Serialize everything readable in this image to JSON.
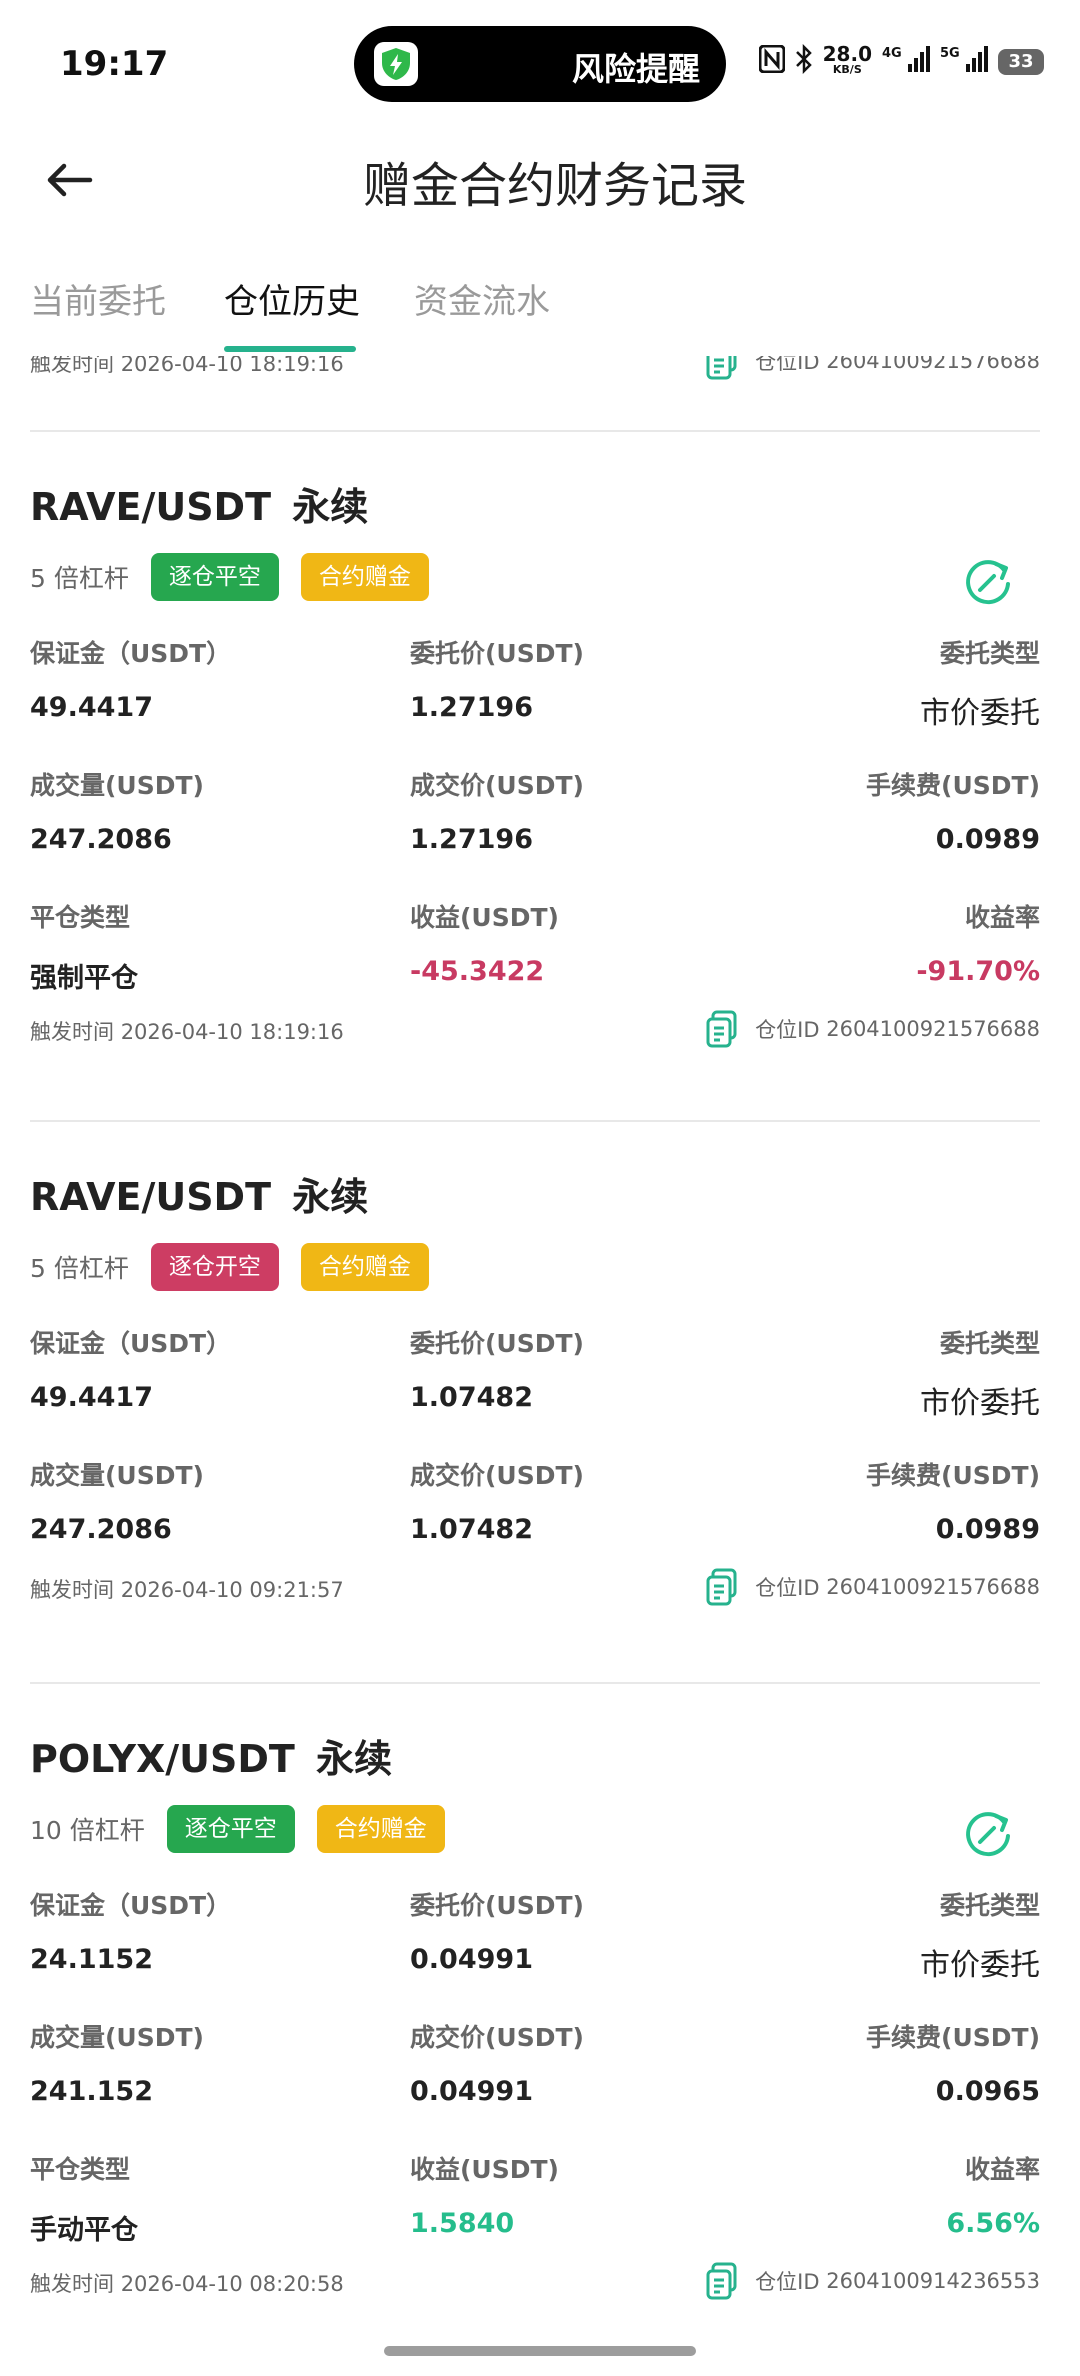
{
  "status_bar": {
    "time": "19:17",
    "island_text": "风险提醒",
    "network_speed": "28.0",
    "network_unit": "KB/S",
    "signal1": "4G",
    "signal2": "5G",
    "battery": "33"
  },
  "header": {
    "title": "赠金合约财务记录"
  },
  "tabs": [
    {
      "label": "当前委托",
      "active": false
    },
    {
      "label": "仓位历史",
      "active": true
    },
    {
      "label": "资金流水",
      "active": false
    }
  ],
  "labels": {
    "margin": "保证金（USDT）",
    "order_price": "委托价(USDT)",
    "order_type": "委托类型",
    "volume": "成交量(USDT)",
    "fill_price": "成交价(USDT)",
    "fee": "手续费(USDT)",
    "close_type": "平仓类型",
    "pnl": "收益(USDT)",
    "pnl_rate": "收益率",
    "trigger_time": "触发时间",
    "position_id": "仓位ID"
  },
  "cards": [
    {
      "trigger_time": "2026-04-10 18:19:16",
      "position_id": "2604100921576688"
    },
    {
      "pair": "RAVE/USDT",
      "perp": "永续",
      "leverage": "5 倍杠杆",
      "side_badge": "逐仓平空",
      "bonus_badge": "合约赠金",
      "margin": "49.4417",
      "order_price": "1.27196",
      "order_type": "市价委托",
      "volume": "247.2086",
      "fill_price": "1.27196",
      "fee": "0.0989",
      "close_type": "强制平仓",
      "pnl": "-45.3422",
      "pnl_rate": "-91.70%",
      "trigger_time": "2026-04-10 18:19:16",
      "position_id": "2604100921576688"
    },
    {
      "pair": "RAVE/USDT",
      "perp": "永续",
      "leverage": "5 倍杠杆",
      "side_badge": "逐仓开空",
      "bonus_badge": "合约赠金",
      "margin": "49.4417",
      "order_price": "1.07482",
      "order_type": "市价委托",
      "volume": "247.2086",
      "fill_price": "1.07482",
      "fee": "0.0989",
      "trigger_time": "2026-04-10 09:21:57",
      "position_id": "2604100921576688"
    },
    {
      "pair": "POLYX/USDT",
      "perp": "永续",
      "leverage": "10 倍杠杆",
      "side_badge": "逐仓平空",
      "bonus_badge": "合约赠金",
      "margin": "24.1152",
      "order_price": "0.04991",
      "order_type": "市价委托",
      "volume": "241.152",
      "fill_price": "0.04991",
      "fee": "0.0965",
      "close_type": "手动平仓",
      "pnl": "1.5840",
      "pnl_rate": "6.56%",
      "trigger_time": "2026-04-10 08:20:58",
      "position_id": "2604100914236553"
    }
  ],
  "colors": {
    "accent": "#26b28d",
    "green_badge": "#26a74f",
    "red_badge": "#cd3d63",
    "yellow_badge": "#f0b715",
    "loss": "#c83a62",
    "gain": "#25bd8c"
  }
}
